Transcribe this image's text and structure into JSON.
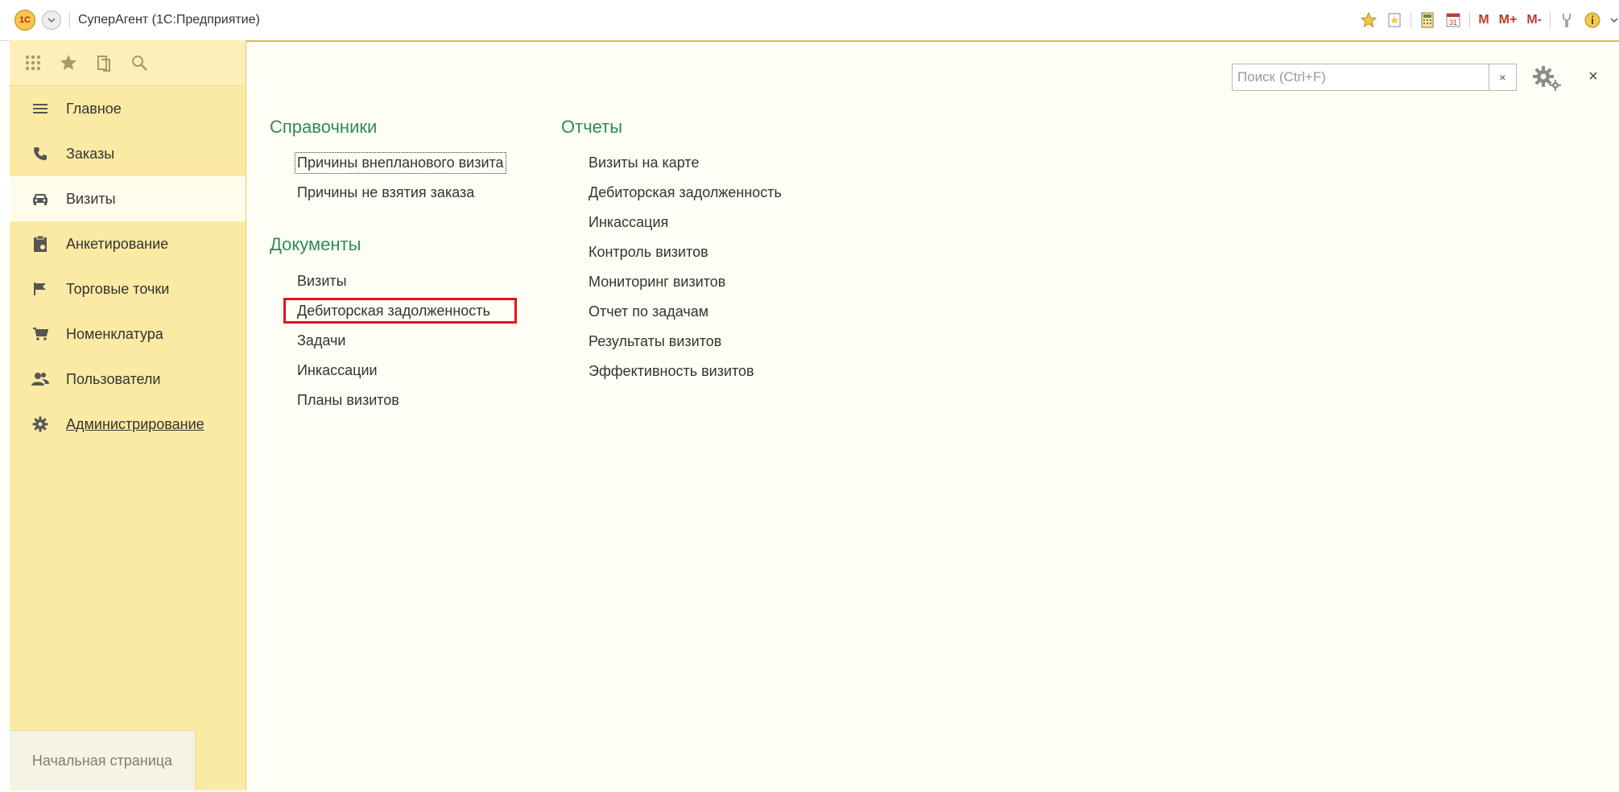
{
  "titlebar": {
    "app_title": "СуперАгент  (1С:Предприятие)",
    "logo_text": "1С",
    "m_label": "M",
    "mplus_label": "M+",
    "mminus_label": "M-",
    "calendar_day": "31"
  },
  "sidebar": {
    "top_icons": [
      "apps-grid-icon",
      "star-icon",
      "history-icon",
      "search-icon"
    ],
    "items": [
      {
        "label": "Главное",
        "icon": "menu-lines-icon"
      },
      {
        "label": "Заказы",
        "icon": "phone-icon"
      },
      {
        "label": "Визиты",
        "icon": "car-icon"
      },
      {
        "label": "Анкетирование",
        "icon": "clipboard-icon"
      },
      {
        "label": "Торговые точки",
        "icon": "flag-icon"
      },
      {
        "label": "Номенклатура",
        "icon": "cart-icon"
      },
      {
        "label": "Пользователи",
        "icon": "users-icon"
      },
      {
        "label": "Администрирование",
        "icon": "gear-icon"
      }
    ],
    "active_item": "Визиты",
    "start_page": "Начальная страница"
  },
  "search": {
    "placeholder": "Поиск (Ctrl+F)",
    "value": "",
    "clear_label": "×"
  },
  "main": {
    "close_label": "×",
    "catalogs": {
      "title": "Справочники",
      "items": [
        "Причины внепланового визита",
        "Причины не взятия заказа"
      ]
    },
    "documents": {
      "title": "Документы",
      "items": [
        "Визиты",
        "Дебиторская задолженность",
        "Задачи",
        "Инкассации",
        "Планы визитов"
      ]
    },
    "reports": {
      "title": "Отчеты",
      "items": [
        "Визиты на карте",
        "Дебиторская задолженность",
        "Инкассация",
        "Контроль визитов",
        "Мониторинг визитов",
        "Отчет по задачам",
        "Результаты визитов",
        "Эффективность визитов"
      ]
    }
  },
  "colors": {
    "accent_green": "#2e8b57",
    "sidebar_bg": "#fbeaa3",
    "main_bg": "#fffef5",
    "highlight_red": "#e0141e"
  }
}
